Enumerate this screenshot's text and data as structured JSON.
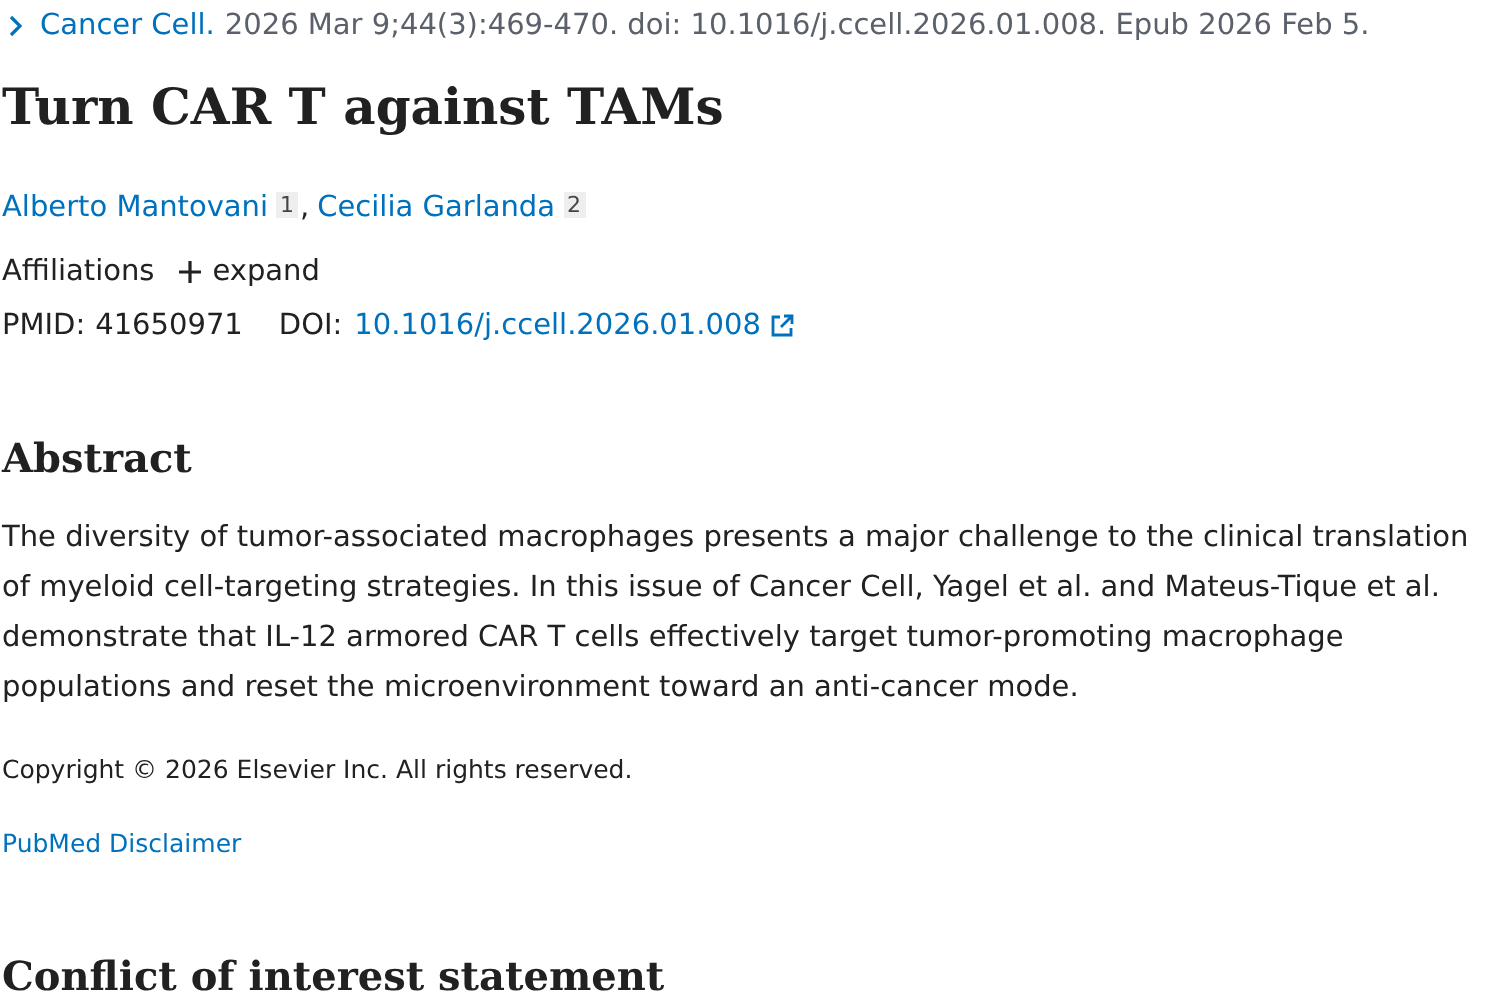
{
  "citation": {
    "journal": "Cancer Cell.",
    "details": "2026 Mar 9;44(3):469-470. doi: 10.1016/j.ccell.2026.01.008. Epub 2026 Feb 5."
  },
  "title": "Turn CAR T against TAMs",
  "authors": [
    {
      "name": "Alberto Mantovani",
      "affiliation": "1"
    },
    {
      "name": "Cecilia Garlanda",
      "affiliation": "2"
    }
  ],
  "author_separator": ",",
  "affiliations": {
    "label": "Affiliations",
    "toggle": "expand",
    "expanded": false
  },
  "identifiers": {
    "pmid_label": "PMID:",
    "pmid": "41650971",
    "doi_label": "DOI:",
    "doi": "10.1016/j.ccell.2026.01.008"
  },
  "abstract": {
    "heading": "Abstract",
    "text": "The diversity of tumor-associated macrophages presents a major challenge to the clinical translation of myeloid cell-targeting strategies. In this issue of Cancer Cell, Yagel et al. and Mateus-Tique et al. demonstrate that IL-12 armored CAR T cells effectively target tumor-promoting macrophage populations and reset the microenvironment toward an anti-cancer mode."
  },
  "copyright": "Copyright © 2026 Elsevier Inc. All rights reserved.",
  "disclaimer": "PubMed Disclaimer",
  "conflict_heading": "Conflict of interest statement"
}
